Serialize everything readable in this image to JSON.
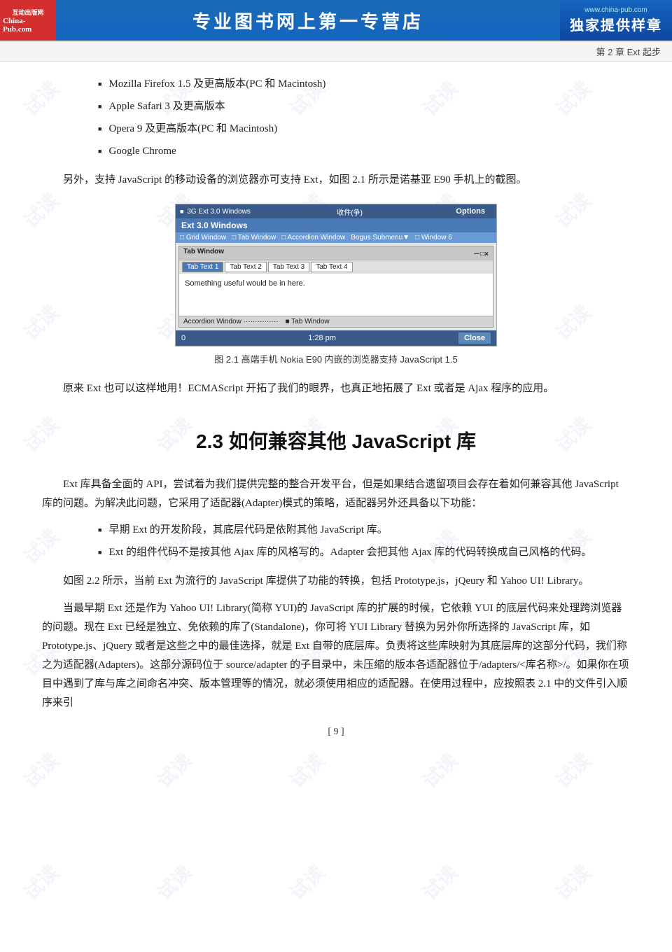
{
  "header": {
    "logo_top": "互动出版网",
    "logo_site": "China-Pub.com",
    "title": "专业图书网上第一专营店",
    "url": "www.china-pub.com",
    "sample": "独家提供样章"
  },
  "chapter_bar": {
    "label": "第 2 章   Ext 起步"
  },
  "watermark": {
    "text": "试读"
  },
  "bullet_items": [
    "Mozilla Firefox 1.5 及更高版本(PC 和 Macintosh)",
    "Apple Safari 3 及更高版本",
    "Opera 9 及更高版本(PC 和 Macintosh)",
    "Google Chrome"
  ],
  "paragraph1": "另外，支持 JavaScript 的移动设备的浏览器亦可支持 Ext，如图 2.1 所示是诺基亚 E90 手机上的截图。",
  "figure": {
    "caption": "图 2.1   高端手机 Nokia E90 内嵌的浏览器支持 JavaScript 1.5",
    "phone": {
      "status_bar_left": "3G Ext 3.0 Windows",
      "status_icon": "收件(争)",
      "options": "Options",
      "title": "Ext 3.0 Windows",
      "menu_items": [
        "Grid Window",
        "Tab Window",
        "Accordion Window",
        "Bogus Submenu▼",
        "Window 6"
      ],
      "tab_window_title": "Tab Window",
      "window_controls": "－□×",
      "tabs": [
        "Tab Text 1",
        "Tab Text 2",
        "Tab Text 3",
        "Tab Text 4"
      ],
      "content": "Something useful would be in here.",
      "accordion_items": [
        "Accordion Window",
        "Tab Window"
      ],
      "bottom_left": "0",
      "time": "1:28 pm",
      "close": "Close"
    }
  },
  "paragraph2": "原来 Ext 也可以这样地用！ECMAScript 开拓了我们的眼界，也真正地拓展了 Ext 或者是 Ajax 程序的应用。",
  "section_heading": "2.3   如何兼容其他 JavaScript 库",
  "paragraph3": "Ext 库具备全面的 API，尝试着为我们提供完整的整合开发平台，但是如果结合遗留项目会存在着如何兼容其他 JavaScript 库的问题。为解决此问题，它采用了适配器(Adapter)模式的策略，适配器另外还具备以下功能：",
  "bullet2_items": [
    "早期 Ext 的开发阶段，其底层代码是依附其他 JavaScript 库。",
    "Ext 的组件代码不是按其他 Ajax 库的风格写的。Adapter 会把其他 Ajax 库的代码转换成自己风格的代码。"
  ],
  "paragraph4": "如图 2.2 所示，当前 Ext 为流行的 JavaScript 库提供了功能的转换，包括 Prototype.js，jQeury 和 Yahoo UI! Library。",
  "paragraph5": "当最早期 Ext 还是作为 Yahoo UI! Library(简称 YUI)的 JavaScript 库的扩展的时候，它依赖 YUI 的底层代码来处理跨浏览器的问题。现在 Ext 已经是独立、免依赖的库了(Standalone)，你可将 YUI Library 替换为另外你所选择的 JavaScript 库，如 Prototype.js、jQuery 或者是这些之中的最佳选择，就是 Ext 自带的底层库。负责将这些库映射为其底层库的这部分代码，我们称之为适配器(Adapters)。这部分源码位于 source/adapter 的子目录中，未压缩的版本各适配器位于/adapters/<库名称>/。如果你在项目中遇到了库与库之间命名冲突、版本管理等的情况，就必须使用相应的适配器。在使用过程中，应按照表 2.1 中的文件引入顺序来引",
  "page_number": "[ 9 ]"
}
